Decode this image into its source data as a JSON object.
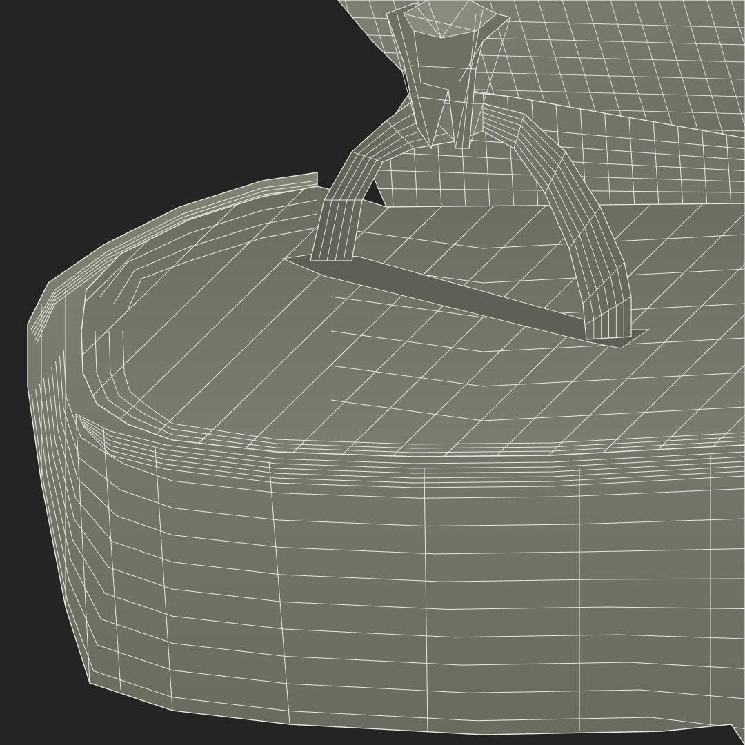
{
  "scene": {
    "subject": "wireframe-render",
    "colors": {
      "background": "#242424",
      "surface_light": "#8a8b7d",
      "surface_mid": "#77786b",
      "surface_dark": "#5c5d52",
      "surface_shadow": "#4a4b42",
      "wire": "#e8e8e2"
    }
  }
}
